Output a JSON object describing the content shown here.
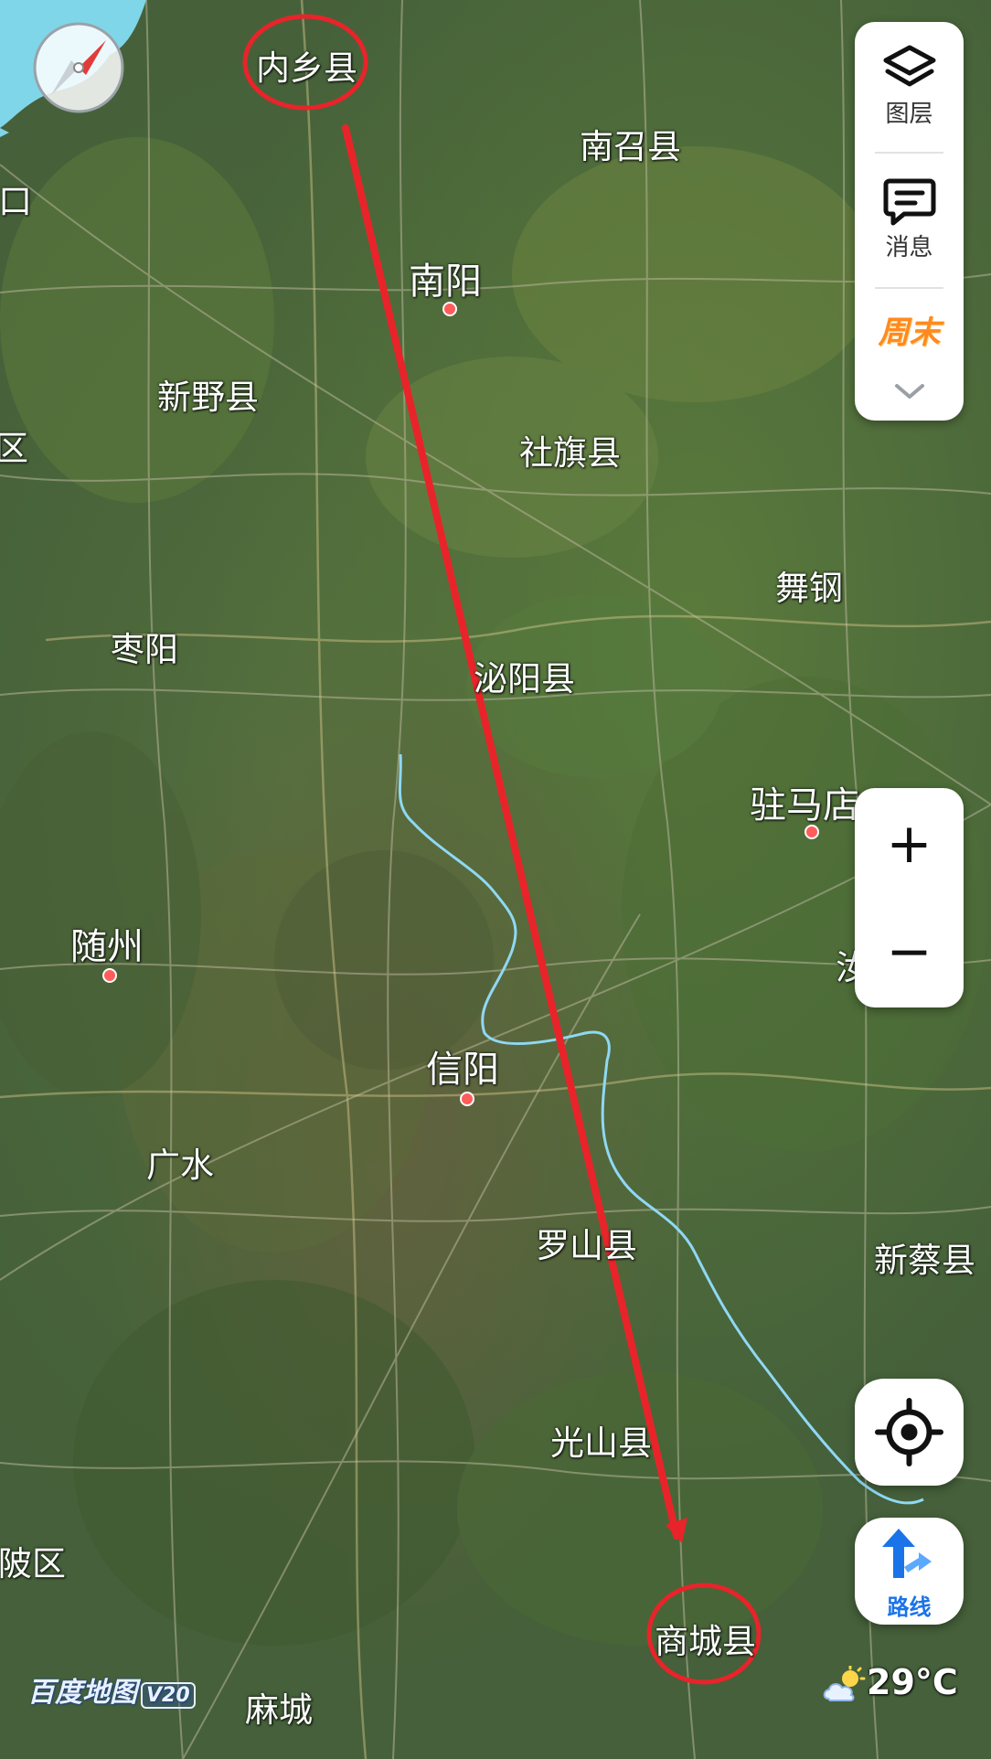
{
  "map": {
    "places": [
      {
        "id": "neixiang",
        "name": "内乡县",
        "kind": "county"
      },
      {
        "id": "nanzhao",
        "name": "南召县",
        "kind": "county"
      },
      {
        "id": "kou",
        "name": "口",
        "kind": "county"
      },
      {
        "id": "nanyang",
        "name": "南阳",
        "kind": "city"
      },
      {
        "id": "xinye",
        "name": "新野县",
        "kind": "county"
      },
      {
        "id": "qu-left",
        "name": "区",
        "kind": "county"
      },
      {
        "id": "sheqi",
        "name": "社旗县",
        "kind": "county"
      },
      {
        "id": "wugang",
        "name": "舞钢",
        "kind": "county"
      },
      {
        "id": "zaoyang",
        "name": "枣阳",
        "kind": "county"
      },
      {
        "id": "biyang",
        "name": "泌阳县",
        "kind": "county"
      },
      {
        "id": "zhumadian",
        "name": "驻马店",
        "kind": "city"
      },
      {
        "id": "suizhou",
        "name": "随州",
        "kind": "city"
      },
      {
        "id": "ru",
        "name": "汝",
        "kind": "county"
      },
      {
        "id": "xinyang",
        "name": "信阳",
        "kind": "city"
      },
      {
        "id": "guangshui",
        "name": "广水",
        "kind": "county"
      },
      {
        "id": "luoshan",
        "name": "罗山县",
        "kind": "county"
      },
      {
        "id": "xincai",
        "name": "新蔡县",
        "kind": "county"
      },
      {
        "id": "guangshan",
        "name": "光山县",
        "kind": "county"
      },
      {
        "id": "huangpi",
        "name": "陂区",
        "kind": "county"
      },
      {
        "id": "shangcheng",
        "name": "商城县",
        "kind": "county"
      },
      {
        "id": "macheng",
        "name": "麻城",
        "kind": "county"
      }
    ],
    "annotation": {
      "color": "#e8242a",
      "start_place": "neixiang",
      "end_place": "shangcheng"
    }
  },
  "controls": {
    "layers_label": "图层",
    "messages_label": "消息",
    "weekend_label": "周末",
    "zoom_in_label": "+",
    "zoom_out_label": "−",
    "route_label": "路线"
  },
  "footer": {
    "logo_text": "百度地图",
    "logo_version": "V20",
    "temperature": "29°C"
  },
  "colors": {
    "accent": "#1a73e8",
    "weekend": "#ff8a1e",
    "river": "#8fd8f5",
    "annotation": "#e8242a"
  }
}
